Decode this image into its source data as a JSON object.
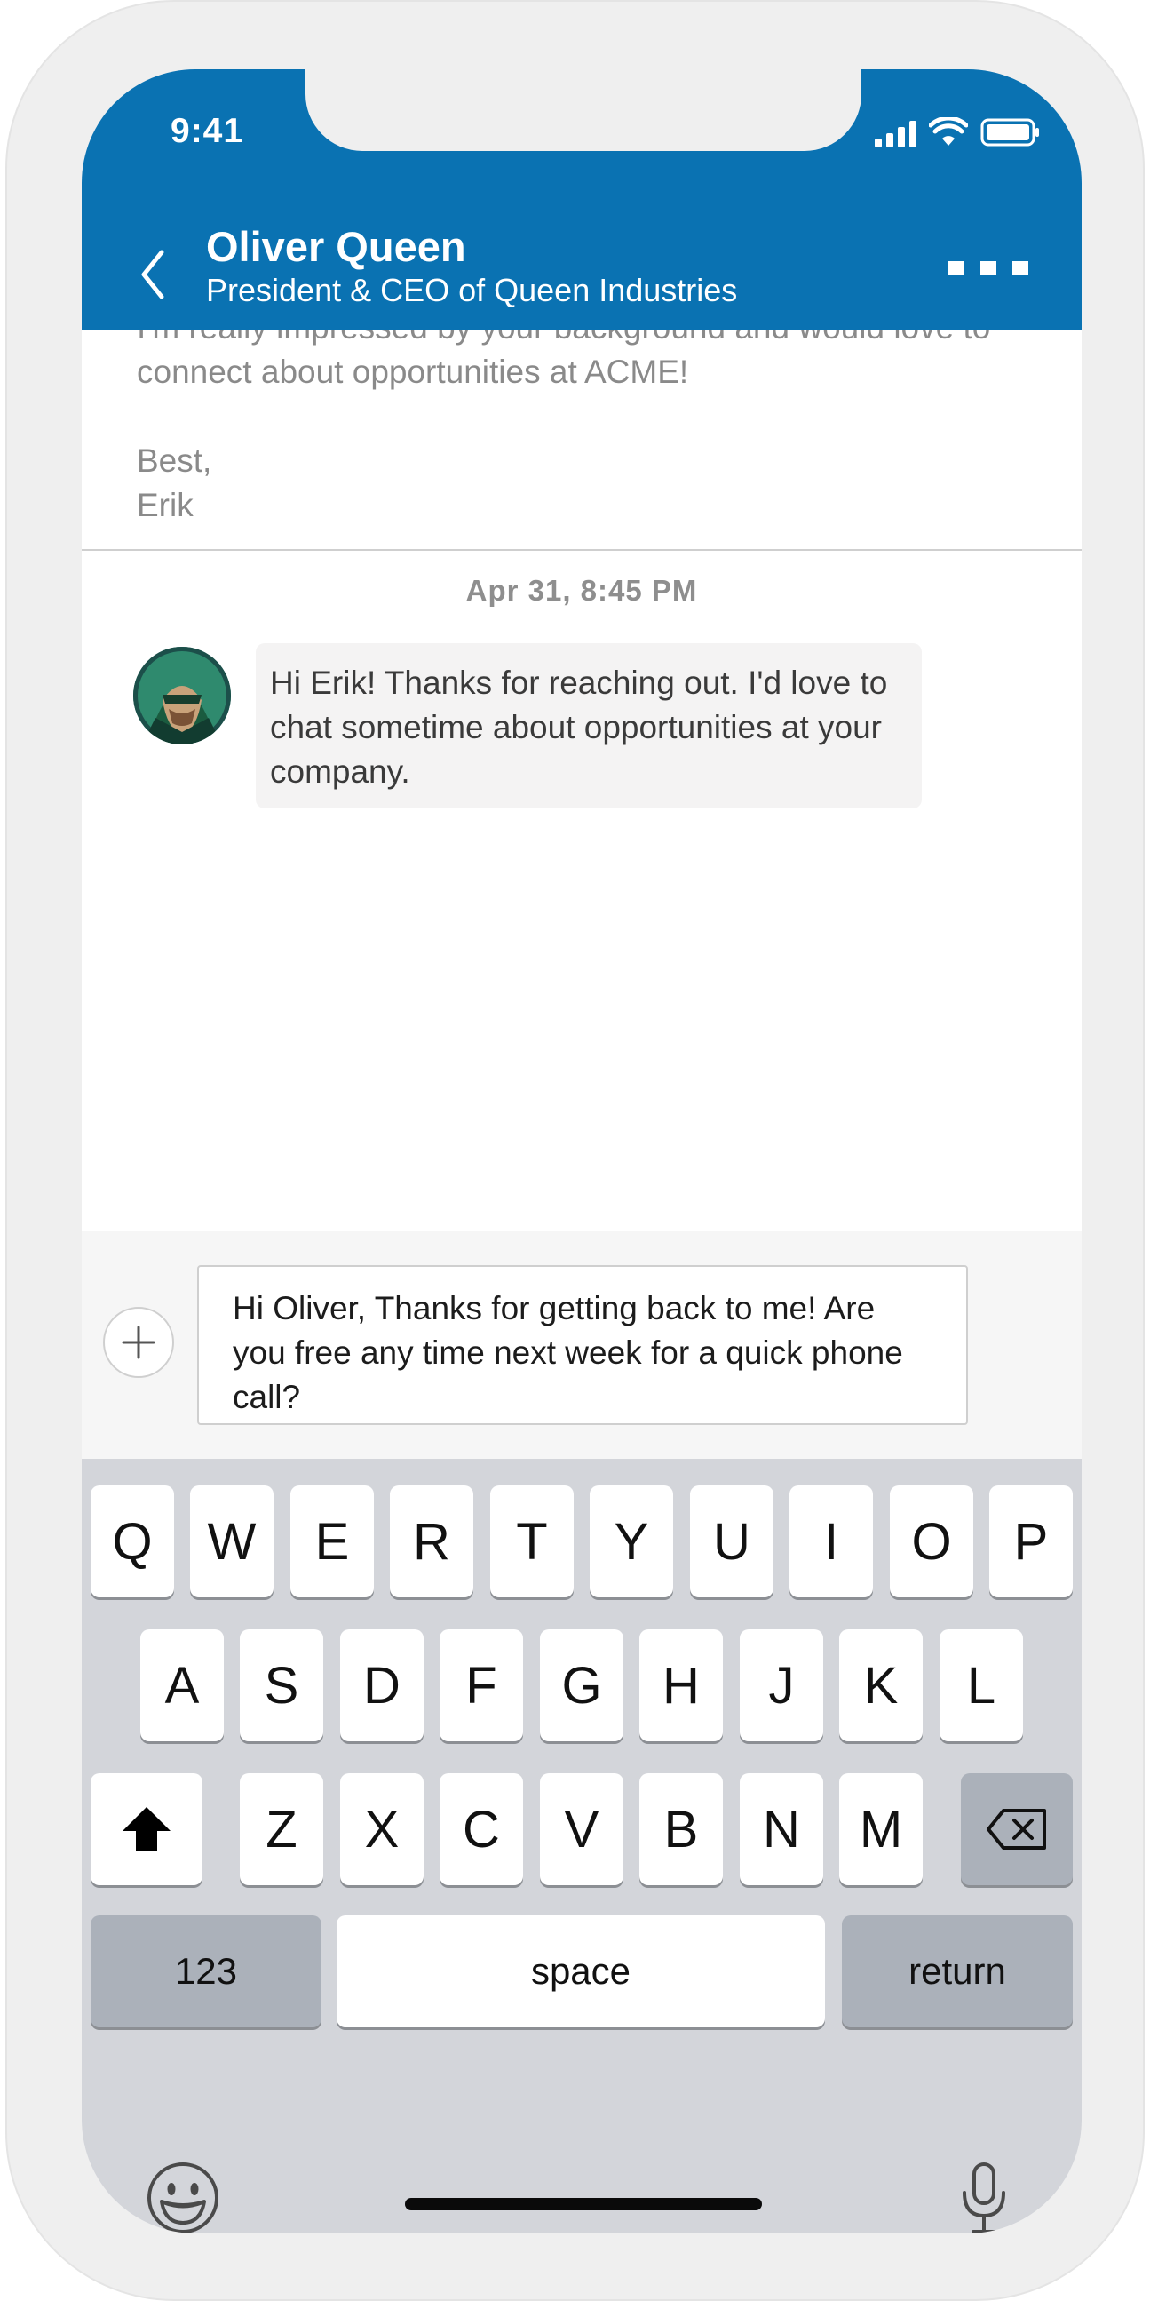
{
  "status_bar": {
    "time": "9:41"
  },
  "header": {
    "title": "Oliver Queen",
    "subtitle": "President & CEO of Queen Industries"
  },
  "thread": {
    "previous_message_text": "I'm really impressed by your background and would love to\nconnect about opportunities at ACME!\n\nBest,\nErik",
    "timestamp": "Apr 31, 8:45 PM",
    "received_message": "Hi Erik! Thanks for reaching out. I'd love to chat sometime about opportunities at your company."
  },
  "compose": {
    "draft": "Hi Oliver, Thanks for getting back to me! Are you free any time next week for a quick phone call?"
  },
  "keyboard": {
    "row1": [
      "Q",
      "W",
      "E",
      "R",
      "T",
      "Y",
      "U",
      "I",
      "O",
      "P"
    ],
    "row2": [
      "A",
      "S",
      "D",
      "F",
      "G",
      "H",
      "J",
      "K",
      "L"
    ],
    "row3": [
      "Z",
      "X",
      "C",
      "V",
      "B",
      "N",
      "M"
    ],
    "numbers_label": "123",
    "space_label": "space",
    "return_label": "return"
  },
  "colors": {
    "header": "#0a72b2",
    "bubble": "#f4f3f3",
    "keyboard": "#d3d5da"
  }
}
